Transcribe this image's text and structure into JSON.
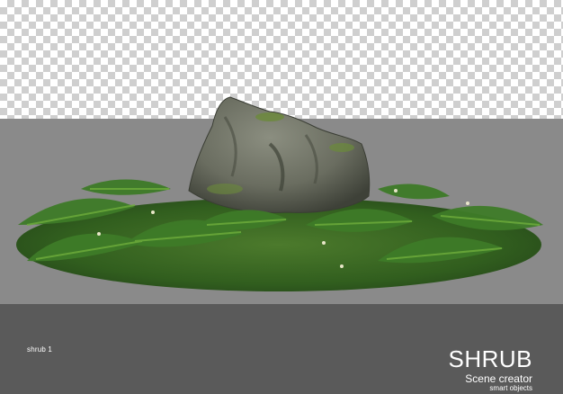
{
  "caption": "shrub 1",
  "brand": {
    "title": "SHRUB",
    "subtitle": "Scene creator",
    "tagline": "smart objects"
  },
  "colors": {
    "checker_light": "#ffffff",
    "checker_dark": "#cfcfcf",
    "ground_band": "#8a8a8a",
    "footer": "#5a5a5a",
    "rock": "#6f7266",
    "moss": "#5f7a3a",
    "fern": "#3f7a2a"
  },
  "icons": [
    "rock-with-ferns-illustration"
  ]
}
